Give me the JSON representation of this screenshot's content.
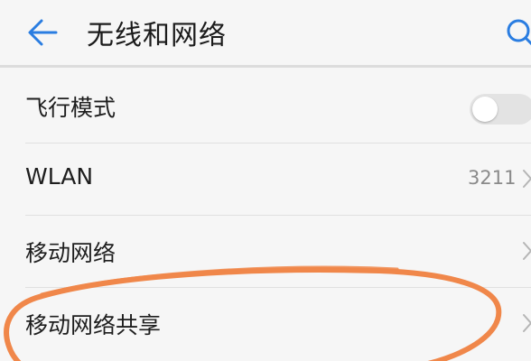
{
  "header": {
    "title": "无线和网络",
    "back_icon": "back-arrow-icon",
    "search_icon": "search-icon"
  },
  "settings": [
    {
      "label": "飞行模式",
      "control": "toggle",
      "toggle_on": false
    },
    {
      "label": "WLAN",
      "value": "3211",
      "control": "chevron"
    },
    {
      "label": "移动网络",
      "control": "chevron"
    },
    {
      "label": "移动网络共享",
      "control": "chevron",
      "highlighted": true
    }
  ],
  "colors": {
    "accent": "#2a7de1",
    "annotation": "#f0874a",
    "background": "#f6f6f6"
  }
}
